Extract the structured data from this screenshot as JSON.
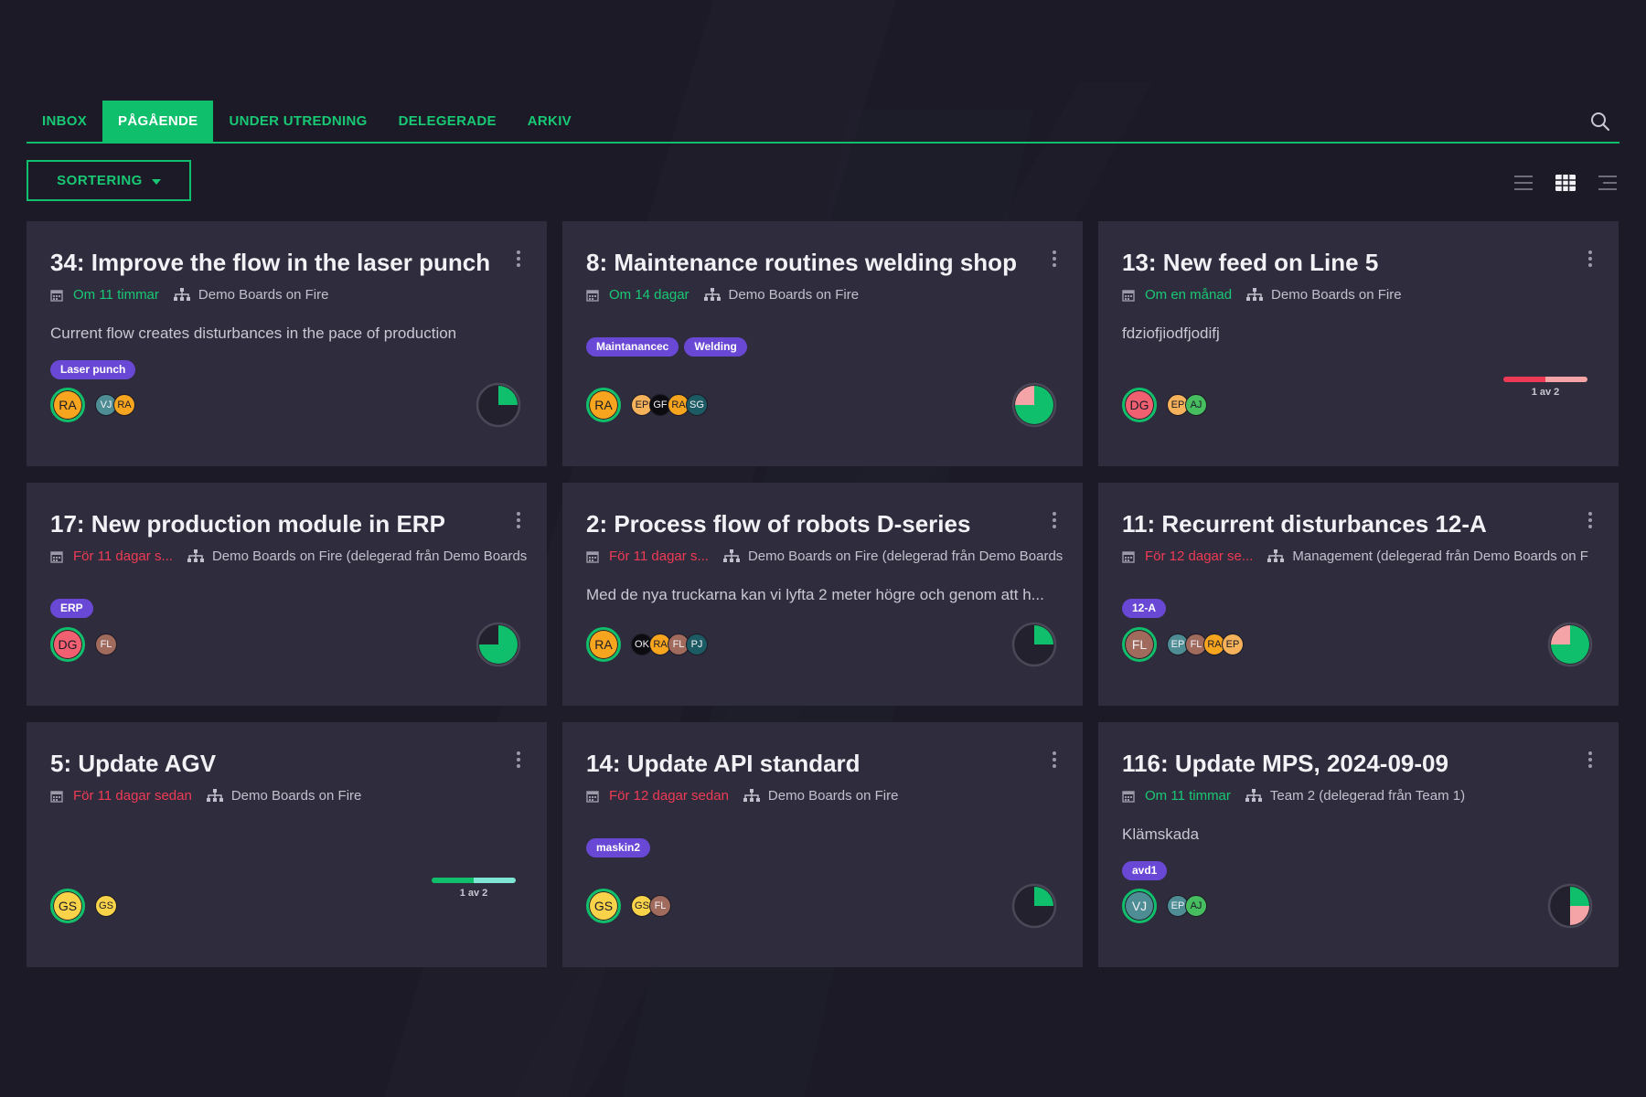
{
  "tabs": [
    {
      "label": "INBOX"
    },
    {
      "label": "PÅGÅENDE",
      "active": true
    },
    {
      "label": "UNDER UTREDNING"
    },
    {
      "label": "DELEGERADE"
    },
    {
      "label": "ARKIV"
    }
  ],
  "toolbar": {
    "sort_label": "SORTERING",
    "search_icon": "search-icon",
    "view_icons": [
      "list-view-icon",
      "grid-view-icon",
      "compact-list-icon"
    ],
    "active_view": "grid"
  },
  "colors": {
    "accent": "#0fbf6b",
    "due_future": "#19c874",
    "due_overdue": "#ef3a55",
    "tag": "#6a48d6",
    "card_bg": "#2f2d3d",
    "page_bg": "#1b1a26"
  },
  "cards": [
    {
      "title": "34: Improve the flow in the laser punch",
      "due": "Om 11 timmar",
      "due_status": "future",
      "board": "Demo Boards on Fire",
      "description": "Current flow creates disturbances in the pace of production",
      "tags": [
        "Laser punch"
      ],
      "owner": {
        "initials": "RA",
        "color": "orange"
      },
      "members": [
        {
          "initials": "VJ",
          "color": "teal"
        },
        {
          "initials": "RA",
          "color": "orange"
        }
      ],
      "status": {
        "type": "pie",
        "done": 0.25,
        "rest": 0,
        "done_color": "#0fbf6b",
        "rest_color": "#f4a3a6"
      }
    },
    {
      "title": "8: Maintenance routines welding shop",
      "due": "Om 14 dagar",
      "due_status": "future",
      "board": "Demo Boards on Fire",
      "description": "",
      "tags": [
        "Maintanancec",
        "Welding"
      ],
      "owner": {
        "initials": "RA",
        "color": "orange"
      },
      "members": [
        {
          "initials": "EP",
          "color": "peach"
        },
        {
          "initials": "GF",
          "color": "black"
        },
        {
          "initials": "RA",
          "color": "orange"
        },
        {
          "initials": "SG",
          "color": "dteal"
        }
      ],
      "status": {
        "type": "pie",
        "done": 0.75,
        "rest": 0.25,
        "done_color": "#0fbf6b",
        "rest_color": "#f4a3a6"
      }
    },
    {
      "title": "13: New feed on Line 5",
      "due": "Om en månad",
      "due_status": "future",
      "board": "Demo Boards on Fire",
      "description": "fdziofjiodfjodifj",
      "tags": [],
      "owner": {
        "initials": "DG",
        "color": "pink"
      },
      "members": [
        {
          "initials": "EP",
          "color": "peach"
        },
        {
          "initials": "AJ",
          "color": "green"
        }
      ],
      "status": {
        "type": "progress",
        "label": "1 av 2",
        "done": 0.5,
        "done_color": "#ef3a55",
        "rest_color": "#f4a3a6"
      }
    },
    {
      "title": "17: New production module in ERP",
      "due": "För 11 dagar s...",
      "due_status": "overdue",
      "board": "Demo Boards on Fire (delegerad från Demo Boards",
      "description": "",
      "tags": [
        "ERP"
      ],
      "owner": {
        "initials": "DG",
        "color": "pink"
      },
      "members": [
        {
          "initials": "FL",
          "color": "brown"
        }
      ],
      "status": {
        "type": "pie",
        "done": 0.75,
        "rest": 0,
        "done_color": "#0fbf6b",
        "rest_color": "#f4a3a6"
      }
    },
    {
      "title": "2: Process flow of robots D-series",
      "due": "För 11 dagar s...",
      "due_status": "overdue",
      "board": "Demo Boards on Fire (delegerad från Demo Boards",
      "description": "Med de nya truckarna kan vi lyfta 2 meter högre och genom att h...",
      "tags": [],
      "owner": {
        "initials": "RA",
        "color": "orange"
      },
      "members": [
        {
          "initials": "OK",
          "color": "black"
        },
        {
          "initials": "RA",
          "color": "orange"
        },
        {
          "initials": "FL",
          "color": "brown"
        },
        {
          "initials": "PJ",
          "color": "dteal"
        }
      ],
      "status": {
        "type": "pie",
        "done": 0.25,
        "rest": 0,
        "done_color": "#0fbf6b",
        "rest_color": "#f4a3a6"
      }
    },
    {
      "title": "11: Recurrent disturbances 12-A",
      "due": "För 12 dagar se...",
      "due_status": "overdue",
      "board": "Management (delegerad från Demo Boards on F",
      "description": "",
      "tags": [
        "12-A"
      ],
      "owner": {
        "initials": "FL",
        "color": "brown"
      },
      "members": [
        {
          "initials": "EP",
          "color": "teal"
        },
        {
          "initials": "FL",
          "color": "brown"
        },
        {
          "initials": "RA",
          "color": "orange"
        },
        {
          "initials": "EP",
          "color": "peach"
        }
      ],
      "status": {
        "type": "pie",
        "done": 0.75,
        "rest": 0.25,
        "done_color": "#0fbf6b",
        "rest_color": "#f4a3a6"
      }
    },
    {
      "title": "5: Update AGV",
      "due": "För 11 dagar sedan",
      "due_status": "overdue",
      "board": "Demo Boards on Fire",
      "description": "",
      "tags": [],
      "owner": {
        "initials": "GS",
        "color": "yellow"
      },
      "members": [
        {
          "initials": "GS",
          "color": "yellow"
        }
      ],
      "status": {
        "type": "progress",
        "label": "1 av 2",
        "done": 0.5,
        "done_color": "#0fbf6b",
        "rest_color": "#7fe5d5"
      }
    },
    {
      "title": "14: Update API standard",
      "due": "För 12 dagar sedan",
      "due_status": "overdue",
      "board": "Demo Boards on Fire",
      "description": "",
      "tags": [
        "maskin2"
      ],
      "owner": {
        "initials": "GS",
        "color": "yellow"
      },
      "members": [
        {
          "initials": "GS",
          "color": "yellow"
        },
        {
          "initials": "FL",
          "color": "brown"
        }
      ],
      "status": {
        "type": "pie",
        "done": 0.25,
        "rest": 0,
        "done_color": "#0fbf6b",
        "rest_color": "#f4a3a6"
      }
    },
    {
      "title": "116: Update MPS, 2024-09-09",
      "due": "Om 11 timmar",
      "due_status": "future",
      "board": "Team 2 (delegerad från Team 1)",
      "description": "Klämskada",
      "tags": [
        "avd1"
      ],
      "owner": {
        "initials": "VJ",
        "color": "teal"
      },
      "members": [
        {
          "initials": "EP",
          "color": "teal"
        },
        {
          "initials": "AJ",
          "color": "green"
        }
      ],
      "status": {
        "type": "pie",
        "done": 0.25,
        "rest": 0.25,
        "done_color": "#0fbf6b",
        "rest_color": "#f4a3a6"
      }
    }
  ]
}
